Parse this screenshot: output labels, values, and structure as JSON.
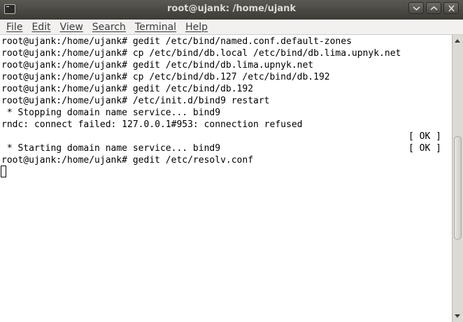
{
  "window": {
    "title": "root@ujank: /home/ujank"
  },
  "menu": {
    "items": [
      {
        "label": "File"
      },
      {
        "label": "Edit"
      },
      {
        "label": "View"
      },
      {
        "label": "Search"
      },
      {
        "label": "Terminal"
      },
      {
        "label": "Help"
      }
    ]
  },
  "terminal": {
    "lines": [
      {
        "text": "root@ujank:/home/ujank# gedit /etc/bind/named.conf.default-zones",
        "right": ""
      },
      {
        "text": "root@ujank:/home/ujank# cp /etc/bind/db.local /etc/bind/db.lima.upnyk.net",
        "right": ""
      },
      {
        "text": "root@ujank:/home/ujank# gedit /etc/bind/db.lima.upnyk.net",
        "right": ""
      },
      {
        "text": "root@ujank:/home/ujank# cp /etc/bind/db.127 /etc/bind/db.192",
        "right": ""
      },
      {
        "text": "root@ujank:/home/ujank# gedit /etc/bind/db.192",
        "right": ""
      },
      {
        "text": "root@ujank:/home/ujank# /etc/init.d/bind9 restart",
        "right": ""
      },
      {
        "text": " * Stopping domain name service... bind9",
        "right": ""
      },
      {
        "text": "rndc: connect failed: 127.0.0.1#953: connection refused",
        "right": ""
      },
      {
        "text": "",
        "right": "[ OK ]"
      },
      {
        "text": " * Starting domain name service... bind9",
        "right": "[ OK ]"
      },
      {
        "text": "root@ujank:/home/ujank# gedit /etc/resolv.conf",
        "right": ""
      }
    ]
  },
  "scrollbar": {
    "position_fraction": 0.56,
    "visible_fraction": 0.39
  }
}
